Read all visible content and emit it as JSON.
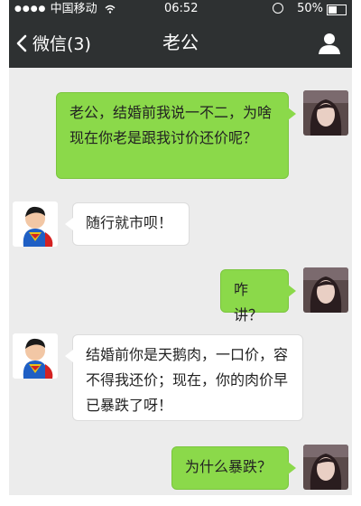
{
  "status_bar": {
    "signal_dots": "●●●●",
    "carrier": "中国移动",
    "time": "06:52",
    "battery_percent": "50%",
    "battery_level": 0.5
  },
  "header": {
    "back_label": "微信(3)",
    "title": "老公"
  },
  "messages": [
    {
      "sender": "me",
      "text": "老公，结婚前我说一不二，为啥现在你老是跟我讨价还价呢？"
    },
    {
      "sender": "other",
      "text": "随行就市呗！"
    },
    {
      "sender": "me",
      "text": "咋讲？"
    },
    {
      "sender": "other",
      "text": "结婚前你是天鹅肉，一口价，容不得我还价；现在，你的肉价早已暴跌了呀！"
    },
    {
      "sender": "me",
      "text": "为什么暴跌？"
    }
  ],
  "colors": {
    "nav_bar": "#2e3132",
    "chat_background": "#ececec",
    "my_bubble": "#8bd94a",
    "other_bubble": "#ffffff"
  },
  "icons": {
    "back": "chevron-left-icon",
    "profile": "person-icon",
    "wifi": "wifi-icon",
    "alarm": "alarm-icon",
    "battery": "battery-icon"
  }
}
